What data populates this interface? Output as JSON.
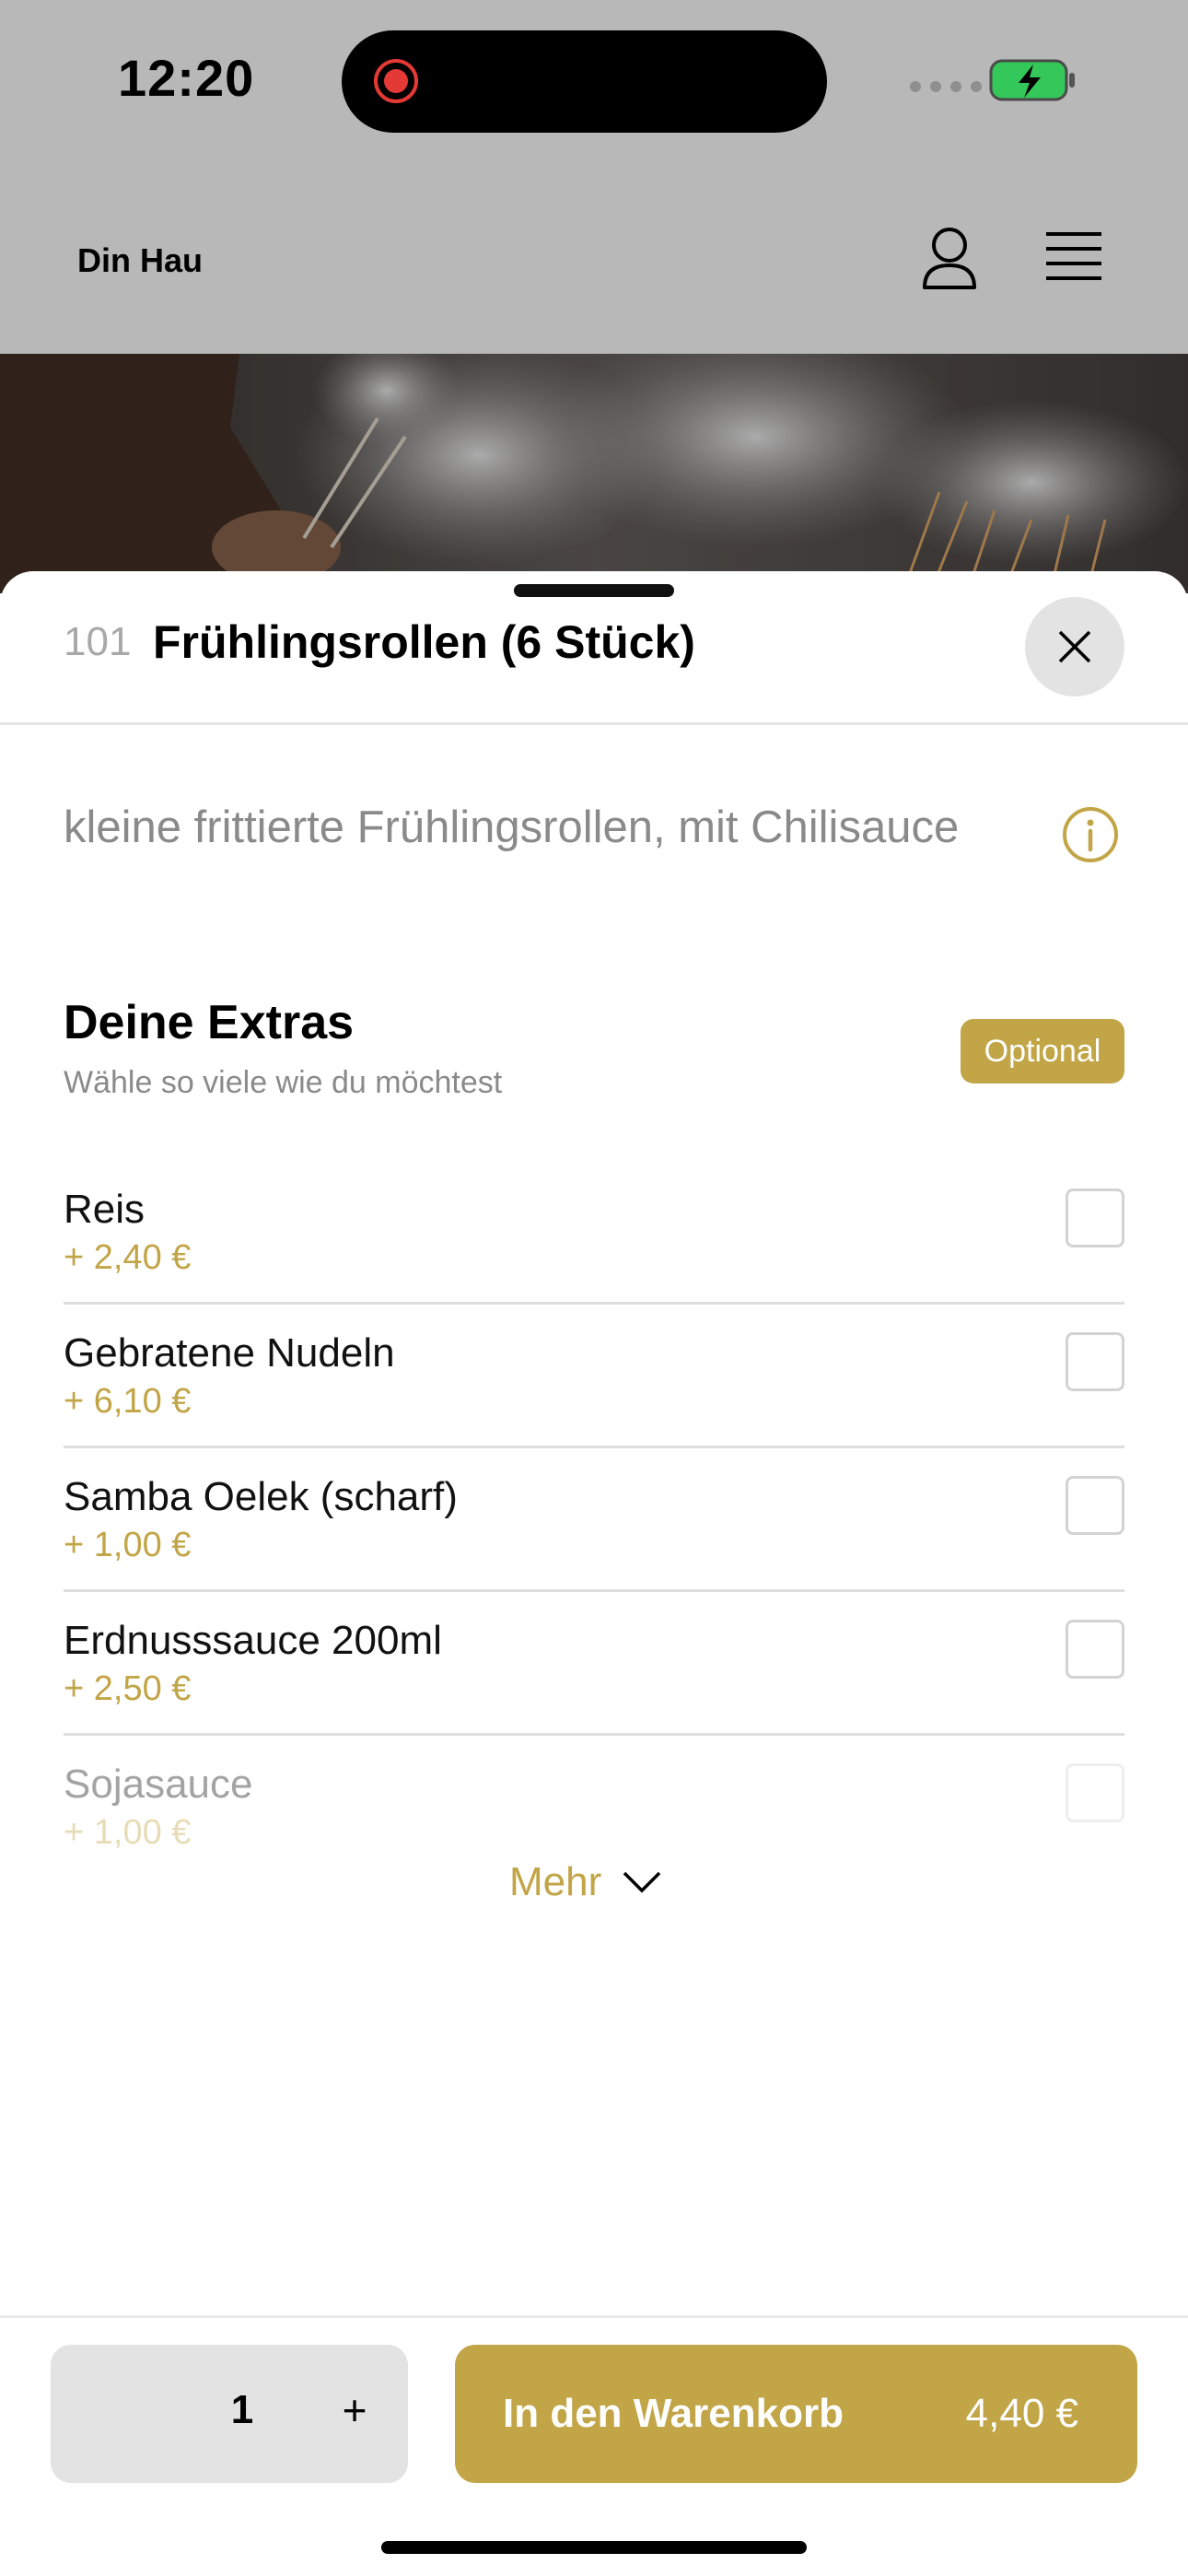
{
  "status_bar": {
    "time": "12:20"
  },
  "header": {
    "brand": "Din Hau"
  },
  "item": {
    "number": "101",
    "title": "Frühlingsrollen (6 Stück)",
    "description": "kleine frittierte Frühlingsrollen, mit Chilisauce"
  },
  "extras": {
    "title": "Deine Extras",
    "subtitle": "Wähle so viele wie du möchtest",
    "badge": "Optional",
    "items": [
      {
        "name": "Reis",
        "price": "+ 2,40 €"
      },
      {
        "name": "Gebratene Nudeln",
        "price": "+ 6,10 €"
      },
      {
        "name": "Samba Oelek (scharf)",
        "price": "+ 1,00 €"
      },
      {
        "name": "Erdnusssauce 200ml",
        "price": "+ 2,50 €"
      },
      {
        "name": "Sojasauce",
        "price": "+ 1,00 €"
      }
    ],
    "more_label": "Mehr"
  },
  "cart": {
    "quantity": "1",
    "plus_label": "+",
    "add_label": "In den Warenkorb",
    "total": "4,40 €"
  },
  "colors": {
    "accent": "#c1a547",
    "overlay": "#b8b8b8"
  }
}
